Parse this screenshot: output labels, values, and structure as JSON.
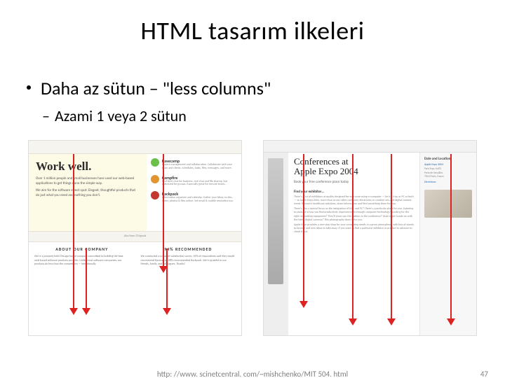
{
  "title": "HTML tasarım ilkeleri",
  "bullet1": "Daha az sütun – \"less columns\"",
  "bullet2": "Azami 1 veya 2 sütun",
  "left_example": {
    "headline": "Work well.",
    "sub1": "Over 1 million people and small businesses have used our web-based applications to get things done the simple way.",
    "sub2": "We aim for the software sweet spot: Elegant, thoughtful products that do just what you need and nothing you don't.",
    "tools": {
      "a_title": "Basecamp",
      "a_desc": "Project management and collaboration. Collaborate with your team and clients. Schedules, tasks, files, messages, and more.",
      "b_title": "Campfire",
      "b_desc": "Real-time chat for business. Live chat and file sharing, but optimized for groups. Especially great for remote teams.",
      "c_title": "Backpack",
      "c_desc": "Information organizer and calendar. Gather your ideas, to-dos, notes, photos & files online. Set email & mobile reminders too."
    },
    "midbar": "Also from 37signals",
    "col1_h": "ABOUT OUR COMPANY",
    "col1_p": "We're a privately held Chicago-based company committed to building the best web-based software products possible. Unlike most software companies, our products do less than the competition — intentionally.",
    "col2_h": "94% RECOMMENDED",
    "col2_p": "We conducted a customer satisfaction survey. 94% of respondents said they would recommend Basecamp; 98% recommended Backpack. We're grateful to our friends, family, and colleagues. Thanks!"
  },
  "right_example": {
    "conf_title_l1": "Conferences at",
    "conf_title_l2": "Apple Expo 2004",
    "conf_sub": "Book your free conference place today",
    "sec1_h": "Find your exhibitor…",
    "sec1_p": "There's a lot of exhibitors at quality designed-for-everyone-using-a-computer — be it a Mac or PC or both — at Apple Expo 2004, more than at any other consumer electronics or creative arts and digital content event. Research healthcare solutions, share information and find something there for you.",
    "sec2_p": "There's also a special focus on the integration of Mac and PC? There's a particular place for you. Listening to podcast is how you find productivity improvements through computer technology? Looking for the right networking equipment? They'll show you the options in the conference? Wait to get hands-on with the latest digital cameras? This photography show is for you.",
    "sec3_p": "Apple Expo provides a one-stop shop for your computing needs in a great atmosphere, with lots of stands to browse and new ideas to take away. If you want to find a particular exhibitor or product in advance to check it out.",
    "side_h": "Date and Location",
    "side_l1": "Apple Expo 2004",
    "side_t1": "Paris Expo, Hall 5",
    "side_t2": "Porte de Versailles",
    "side_t3": "75015 Paris, France",
    "side_l2": "Directions"
  },
  "footer_src": "http: //www. scinetcentral. com/~mishchenko/MIT 504. html",
  "page_no": "47"
}
